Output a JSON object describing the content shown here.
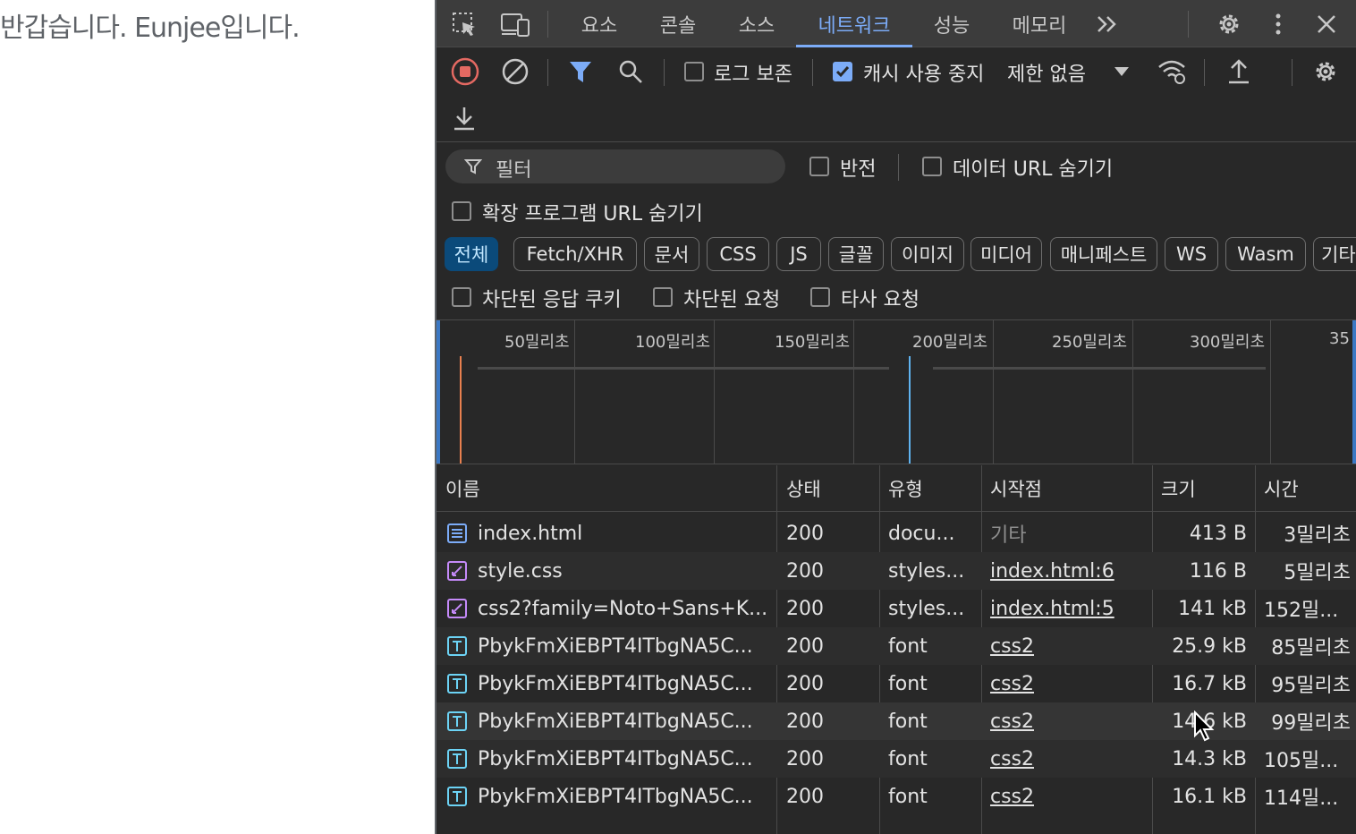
{
  "page": {
    "text": "반갑습니다. Eunjee입니다."
  },
  "devtools": {
    "tabs": [
      "요소",
      "콘솔",
      "소스",
      "네트워크",
      "성능",
      "메모리"
    ],
    "active_tab": "네트워크",
    "more_tabs_icon": "chevron-double-right-icon",
    "toolbar": {
      "preserve_log": {
        "label": "로그 보존",
        "checked": false
      },
      "disable_cache": {
        "label": "캐시 사용 중지",
        "checked": true
      },
      "throttle": "제한 없음"
    },
    "filter": {
      "placeholder": "필터",
      "invert": {
        "label": "반전",
        "checked": false
      },
      "hide_data_urls": {
        "label": "데이터 URL 숨기기",
        "checked": false
      },
      "hide_extension_urls": {
        "label": "확장 프로그램 URL 숨기기",
        "checked": false
      }
    },
    "type_chips": [
      "전체",
      "Fetch/XHR",
      "문서",
      "CSS",
      "JS",
      "글꼴",
      "이미지",
      "미디어",
      "매니페스트",
      "WS",
      "Wasm",
      "기타"
    ],
    "active_chip": "전체",
    "more_filters": {
      "blocked_cookies": "차단된 응답 쿠키",
      "blocked_requests": "차단된 요청",
      "third_party": "타사 요청"
    },
    "timeline": {
      "ticks": [
        "50밀리초",
        "100밀리초",
        "150밀리초",
        "200밀리초",
        "250밀리초",
        "300밀리초",
        "35"
      ]
    },
    "table": {
      "columns": [
        "이름",
        "상태",
        "유형",
        "시작점",
        "크기",
        "시간"
      ],
      "rows": [
        {
          "icon": "document-icon",
          "name": "index.html",
          "status": "200",
          "type": "docu...",
          "initiator": "기타",
          "size": "413 B",
          "time": "3밀리초"
        },
        {
          "icon": "stylesheet-icon",
          "name": "style.css",
          "status": "200",
          "type": "styles...",
          "initiator": "index.html:6",
          "size": "116 B",
          "time": "5밀리초"
        },
        {
          "icon": "stylesheet-icon",
          "name": "css2?family=Noto+Sans+K...",
          "status": "200",
          "type": "styles...",
          "initiator": "index.html:5",
          "size": "141 kB",
          "time": "152밀..."
        },
        {
          "icon": "font-icon",
          "name": "PbykFmXiEBPT4ITbgNA5C...",
          "status": "200",
          "type": "font",
          "initiator": "css2",
          "size": "25.9 kB",
          "time": "85밀리초"
        },
        {
          "icon": "font-icon",
          "name": "PbykFmXiEBPT4ITbgNA5C...",
          "status": "200",
          "type": "font",
          "initiator": "css2",
          "size": "16.7 kB",
          "time": "95밀리초"
        },
        {
          "icon": "font-icon",
          "name": "PbykFmXiEBPT4ITbgNA5C...",
          "status": "200",
          "type": "font",
          "initiator": "css2",
          "size": "14.6 kB",
          "time": "99밀리초"
        },
        {
          "icon": "font-icon",
          "name": "PbykFmXiEBPT4ITbgNA5C...",
          "status": "200",
          "type": "font",
          "initiator": "css2",
          "size": "14.3 kB",
          "time": "105밀..."
        },
        {
          "icon": "font-icon",
          "name": "PbykFmXiEBPT4ITbgNA5C...",
          "status": "200",
          "type": "font",
          "initiator": "css2",
          "size": "16.1 kB",
          "time": "114밀..."
        }
      ]
    },
    "colors": {
      "accent": "#7cacf8",
      "record": "#e46962",
      "doc_icon": "#7cacf8",
      "css_icon": "#c58af9",
      "font_icon": "#6cd3f5"
    }
  }
}
